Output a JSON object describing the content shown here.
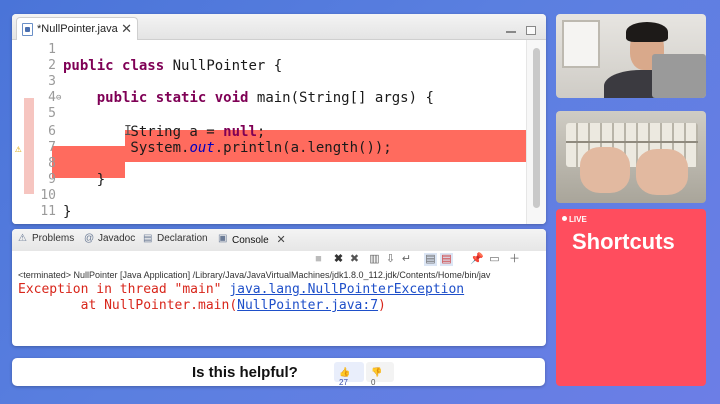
{
  "editor": {
    "tab_title": "*NullPointer.java",
    "lines": [
      {
        "n": "1",
        "html": ""
      },
      {
        "n": "2",
        "html": "<span class='kw'>public</span> <span class='kw'>class</span> NullPointer {"
      },
      {
        "n": "3",
        "html": ""
      },
      {
        "n": "4",
        "html": "    <span class='kw'>public</span> <span class='kw'>static</span> <span class='kw'>void</span> main(String[] args) {"
      },
      {
        "n": "5",
        "html": ""
      },
      {
        "n": "6",
        "html": "        String a = <span class='kw'>null</span>;"
      },
      {
        "n": "7",
        "html": "        System.<span class='fld'>out</span>.println(a.length());"
      },
      {
        "n": "8",
        "html": ""
      },
      {
        "n": "9",
        "html": "    }"
      },
      {
        "n": "10",
        "html": ""
      },
      {
        "n": "11",
        "html": "}"
      }
    ]
  },
  "console": {
    "tabs": [
      {
        "label": "Problems",
        "icon": "problems-icon"
      },
      {
        "label": "Javadoc",
        "icon": "javadoc-icon"
      },
      {
        "label": "Declaration",
        "icon": "declaration-icon"
      },
      {
        "label": "Console",
        "icon": "console-icon"
      }
    ],
    "terminated_line": "<terminated> NullPointer [Java Application] /Library/Java/JavaVirtualMachines/jdk1.8.0_112.jdk/Contents/Home/bin/jav",
    "exception_prefix": "Exception in thread \"main\" ",
    "exception_link": "java.lang.NullPointerException",
    "stack_prefix": "        at NullPointer.main(",
    "stack_link": "NullPointer.java:7",
    "stack_suffix": ")"
  },
  "feedback": {
    "question": "Is this helpful?",
    "likes": "27",
    "dislikes": "0"
  },
  "shortcuts": {
    "live": "LIVE",
    "title": "Shortcuts"
  },
  "colors": {
    "error_highlight": "#ff6b5e",
    "keyword": "#7f0055",
    "console_error": "#d8261b",
    "shortcuts_bg": "#ff4d5e"
  }
}
